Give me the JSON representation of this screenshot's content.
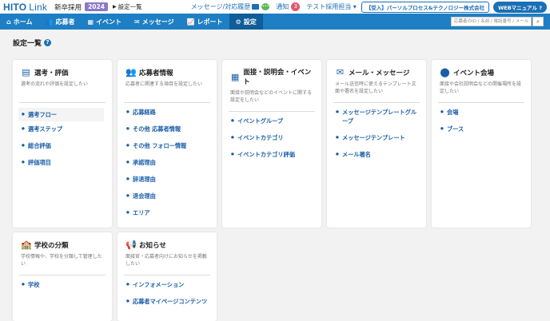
{
  "header": {
    "logo_main": "HITO",
    "logo_sub": "Link",
    "recruit_type": "新卒採用",
    "year": "2024",
    "breadcrumb": "設定一覧",
    "message_link": "メッセージ/対応履歴",
    "notify_label": "通知",
    "notify_count": "3",
    "user_label": "テスト採用担当",
    "company": "【受入】パーソルプロセス&テクノロジー株式会社",
    "manual_label": "WEBマニュアル"
  },
  "nav": {
    "items": [
      {
        "label": "ホーム",
        "icon": "home-icon"
      },
      {
        "label": "応募者",
        "icon": "users-icon"
      },
      {
        "label": "イベント",
        "icon": "calendar-icon"
      },
      {
        "label": "メッセージ",
        "icon": "mail-icon"
      },
      {
        "label": "レポート",
        "icon": "chart-icon"
      },
      {
        "label": "設定",
        "icon": "gear-icon"
      }
    ],
    "active": "設定",
    "search_placeholder": "応募者のID / 名前 / 電話番号 / メール"
  },
  "page": {
    "title": "設定一覧"
  },
  "cards": [
    {
      "title": "選考・評価",
      "icon": "document-icon",
      "desc": "選考の流れや評価を設定したい",
      "items": [
        "選考フロー",
        "選考ステップ",
        "総合評価",
        "評価項目"
      ]
    },
    {
      "title": "応募者情報",
      "icon": "users-icon",
      "desc": "応募者に関連する項目を設定したい",
      "items": [
        "応募経路",
        "その他 応募者情報",
        "その他 フォロー情報",
        "承諾理由",
        "辞退理由",
        "退会理由",
        "エリア"
      ]
    },
    {
      "title": "面接・説明会・イベント",
      "icon": "calendar-icon",
      "desc": "面接や説明会などのイベントに関する設定をしたい",
      "items": [
        "イベントグループ",
        "イベントカテゴリ",
        "イベントカテゴリ評価"
      ]
    },
    {
      "title": "メール・メッセージ",
      "icon": "mail-icon",
      "desc": "メール送信時に使えるテンプレート文面や署名を設定したい",
      "items": [
        "メッセージテンプレートグループ",
        "メッセージテンプレート",
        "メール署名"
      ]
    },
    {
      "title": "イベント会場",
      "icon": "location-pin-icon",
      "desc": "面接や会社説明会などの開催場所を設定したい",
      "items": [
        "会場",
        "ブース"
      ]
    },
    {
      "title": "学校の分類",
      "icon": "school-icon",
      "desc": "学校情報や、学校を分類して管理したい",
      "items": [
        "学校"
      ]
    },
    {
      "title": "お知らせ",
      "icon": "megaphone-icon",
      "desc": "面接官・応募者向けにお知らせを掲載したい",
      "items": [
        "インフォメーション",
        "応募者マイページコンテンツ"
      ]
    }
  ]
}
